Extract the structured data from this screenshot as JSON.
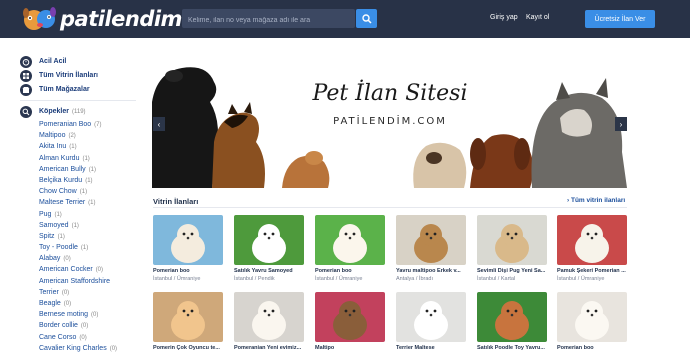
{
  "header": {
    "logo_text": "patilendim",
    "search_placeholder": "Kelime, ilan no veya mağaza adı ile ara",
    "login": "Giriş yap",
    "register": "Kayıt ol",
    "cta": "Ücretsiz İlan Ver"
  },
  "sidebar": {
    "main": [
      {
        "label": "Acil Acil",
        "icon": "alarm-clock-icon"
      },
      {
        "label": "Tüm Vitrin İlanları",
        "icon": "grid-icon"
      },
      {
        "label": "Tüm Mağazalar",
        "icon": "store-icon"
      }
    ],
    "category": {
      "label": "Köpekler",
      "count": "(119)",
      "icon": "search-icon"
    },
    "subcats": [
      {
        "label": "Pomeranian Boo",
        "count": "(7)"
      },
      {
        "label": "Maltipoo",
        "count": "(2)"
      },
      {
        "label": "Akita Inu",
        "count": "(1)"
      },
      {
        "label": "Alman Kurdu",
        "count": "(1)"
      },
      {
        "label": "American Bully",
        "count": "(1)"
      },
      {
        "label": "Belçika Kurdu",
        "count": "(1)"
      },
      {
        "label": "Chow Chow",
        "count": "(1)"
      },
      {
        "label": "Maltese Terrier",
        "count": "(1)"
      },
      {
        "label": "Pug",
        "count": "(1)"
      },
      {
        "label": "Samoyed",
        "count": "(1)"
      },
      {
        "label": "Spitz",
        "count": "(1)"
      },
      {
        "label": "Toy - Poodle",
        "count": "(1)"
      },
      {
        "label": "Alabay",
        "count": "(0)"
      },
      {
        "label": "American Cocker",
        "count": "(0)"
      },
      {
        "label": "American Staffordshire",
        "count": ""
      },
      {
        "label": "Terrier",
        "count": "(0)"
      },
      {
        "label": "Beagle",
        "count": "(0)"
      },
      {
        "label": "Bernese moting",
        "count": "(0)"
      },
      {
        "label": "Border collie",
        "count": "(0)"
      },
      {
        "label": "Cane Corso",
        "count": "(0)"
      },
      {
        "label": "Cavalier King Charles",
        "count": "(0)"
      }
    ]
  },
  "banner": {
    "title": "Pet İlan Sitesi",
    "subtitle": "PATİLENDİM.COM"
  },
  "vitrin": {
    "title": "Vitrin İlanları",
    "all_link": "Tüm vitrin ilanları",
    "cards": [
      {
        "title": "Pomerian boo",
        "location": "İstanbul / Ümraniye",
        "bg": "#7fb8dc",
        "dog": "#f4ecde"
      },
      {
        "title": "Satılık Yavru Samoyed",
        "location": "İstanbul / Pendik",
        "bg": "#4e9a3c",
        "dog": "#ffffff"
      },
      {
        "title": "Pomerian boo",
        "location": "İstanbul / Ümraniye",
        "bg": "#5bb24a",
        "dog": "#fbf6ec"
      },
      {
        "title": "Yavru maltipoo Erkek v...",
        "location": "Antalya / İbradı",
        "bg": "#d8d2c6",
        "dog": "#b9874d"
      },
      {
        "title": "Sevimli Dişi Pug Yeni Sa...",
        "location": "İstanbul / Kartal",
        "bg": "#d9d9d2",
        "dog": "#d9b98a"
      },
      {
        "title": "Pamuk Şekeri Pomerian ...",
        "location": "İstanbul / Ümraniye",
        "bg": "#c94a4a",
        "dog": "#f7f3ea"
      },
      {
        "title": "Pomerin Çok Oyuncu te...",
        "location": "",
        "bg": "#cfa87a",
        "dog": "#f1c58d"
      },
      {
        "title": "Pomeranian Yeni evimiz...",
        "location": "",
        "bg": "#d7d4cf",
        "dog": "#faf6ef"
      },
      {
        "title": "Maltipo",
        "location": "",
        "bg": "#c2415d",
        "dog": "#8a5e3a"
      },
      {
        "title": "Terrier Maltese",
        "location": "",
        "bg": "#e2e2e0",
        "dog": "#ffffff"
      },
      {
        "title": "Satılık Poodle Toy Yavru...",
        "location": "",
        "bg": "#3d8a38",
        "dog": "#c8743e"
      },
      {
        "title": "Pomerian boo",
        "location": "",
        "bg": "#e8e4de",
        "dog": "#fbf8f2"
      }
    ]
  },
  "colors": {
    "header_bg": "#283247",
    "accent": "#3a8ee6",
    "link": "#1c4f9c"
  }
}
